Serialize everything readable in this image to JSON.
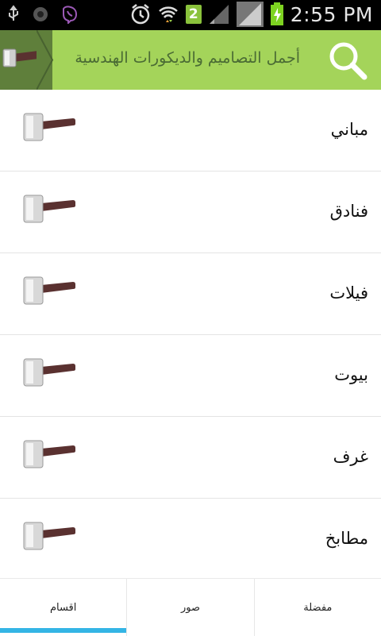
{
  "statusbar": {
    "time": "2:55 PM",
    "badge": "2",
    "icons": [
      "usb-icon",
      "record-icon",
      "viber-icon",
      "alarm-icon",
      "wifi-icon",
      "sim-badge-icon",
      "signal-icon",
      "signal-icon-2",
      "battery-charging-icon"
    ]
  },
  "appbar": {
    "title": "أجمل التصاميم والديكورات الهندسية",
    "left_icon": "hammer-icon",
    "search_icon": "search-icon",
    "color": "#a4d45a"
  },
  "categories": [
    {
      "label": "مباني",
      "icon": "hammer-icon"
    },
    {
      "label": "فنادق",
      "icon": "hammer-icon"
    },
    {
      "label": "فيلات",
      "icon": "hammer-icon"
    },
    {
      "label": "بيوت",
      "icon": "hammer-icon"
    },
    {
      "label": "غرف",
      "icon": "hammer-icon"
    },
    {
      "label": "مطابخ",
      "icon": "hammer-icon"
    }
  ],
  "tabs": [
    {
      "label": "اقسام",
      "active": true
    },
    {
      "label": "صور",
      "active": false
    },
    {
      "label": "مفضلة",
      "active": false
    }
  ],
  "colors": {
    "accent": "#34b5e5",
    "appbar": "#a4d45a",
    "appbar_dark": "#5f7f3b"
  }
}
